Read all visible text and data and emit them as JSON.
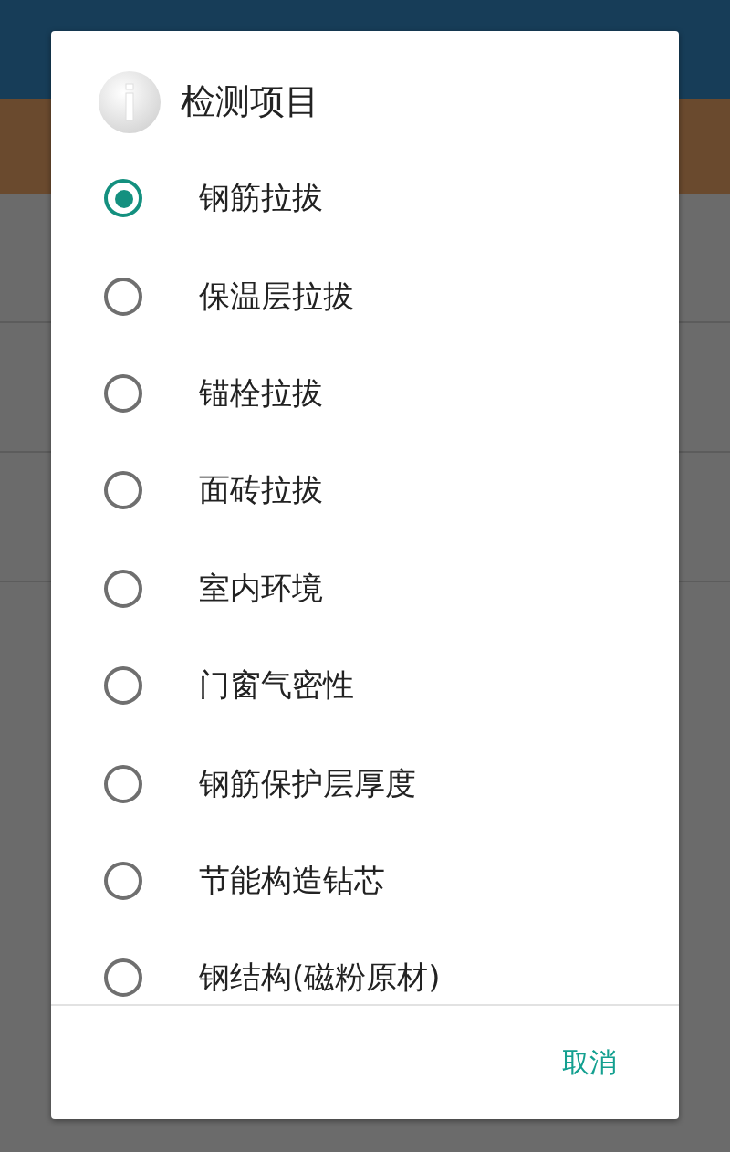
{
  "dialog": {
    "title": "检测项目",
    "options": [
      {
        "label": "钢筋拉拔",
        "selected": true
      },
      {
        "label": "保温层拉拔",
        "selected": false
      },
      {
        "label": "锚栓拉拔",
        "selected": false
      },
      {
        "label": "面砖拉拔",
        "selected": false
      },
      {
        "label": "室内环境",
        "selected": false
      },
      {
        "label": "门窗气密性",
        "selected": false
      },
      {
        "label": "钢筋保护层厚度",
        "selected": false
      },
      {
        "label": "节能构造钻芯",
        "selected": false
      },
      {
        "label": "钢结构(磁粉原材)",
        "selected": false
      }
    ],
    "buttons": [
      "取消"
    ]
  }
}
